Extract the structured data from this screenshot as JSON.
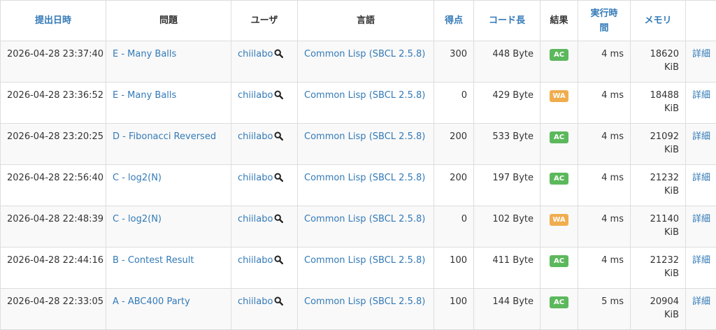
{
  "columns": {
    "submit_time": "提出日時",
    "task": "問題",
    "user": "ユーザ",
    "language": "言語",
    "score": "得点",
    "code_length": "コード長",
    "result": "結果",
    "exec_time_1": "実行時",
    "exec_time_2": "間",
    "memory": "メモリ"
  },
  "colors": {
    "link": "#337ab7",
    "AC": "#5cb85c",
    "WA": "#f0ad4e"
  },
  "icons": {
    "user_search": "search-icon"
  },
  "rows": [
    {
      "time": "2026-04-28 23:37:40",
      "task": "E - Many Balls",
      "user": "chiilabo",
      "lang": "Common Lisp (SBCL 2.5.8)",
      "score": "300",
      "len": "448 Byte",
      "status": "AC",
      "exec": "4 ms",
      "mem1": "18620",
      "mem2": "KiB",
      "detail": "詳細"
    },
    {
      "time": "2026-04-28 23:36:52",
      "task": "E - Many Balls",
      "user": "chiilabo",
      "lang": "Common Lisp (SBCL 2.5.8)",
      "score": "0",
      "len": "429 Byte",
      "status": "WA",
      "exec": "4 ms",
      "mem1": "18488",
      "mem2": "KiB",
      "detail": "詳細"
    },
    {
      "time": "2026-04-28 23:20:25",
      "task": "D - Fibonacci Reversed",
      "user": "chiilabo",
      "lang": "Common Lisp (SBCL 2.5.8)",
      "score": "200",
      "len": "533 Byte",
      "status": "AC",
      "exec": "4 ms",
      "mem1": "21092",
      "mem2": "KiB",
      "detail": "詳細"
    },
    {
      "time": "2026-04-28 22:56:40",
      "task": "C - log2(N)",
      "user": "chiilabo",
      "lang": "Common Lisp (SBCL 2.5.8)",
      "score": "200",
      "len": "197 Byte",
      "status": "AC",
      "exec": "4 ms",
      "mem1": "21232",
      "mem2": "KiB",
      "detail": "詳細"
    },
    {
      "time": "2026-04-28 22:48:39",
      "task": "C - log2(N)",
      "user": "chiilabo",
      "lang": "Common Lisp (SBCL 2.5.8)",
      "score": "0",
      "len": "102 Byte",
      "status": "WA",
      "exec": "4 ms",
      "mem1": "21140",
      "mem2": "KiB",
      "detail": "詳細"
    },
    {
      "time": "2026-04-28 22:44:16",
      "task": "B - Contest Result",
      "user": "chiilabo",
      "lang": "Common Lisp (SBCL 2.5.8)",
      "score": "100",
      "len": "411 Byte",
      "status": "AC",
      "exec": "4 ms",
      "mem1": "21232",
      "mem2": "KiB",
      "detail": "詳細"
    },
    {
      "time": "2026-04-28 22:33:05",
      "task": "A - ABC400 Party",
      "user": "chiilabo",
      "lang": "Common Lisp (SBCL 2.5.8)",
      "score": "100",
      "len": "144 Byte",
      "status": "AC",
      "exec": "5 ms",
      "mem1": "20904",
      "mem2": "KiB",
      "detail": "詳細"
    }
  ]
}
